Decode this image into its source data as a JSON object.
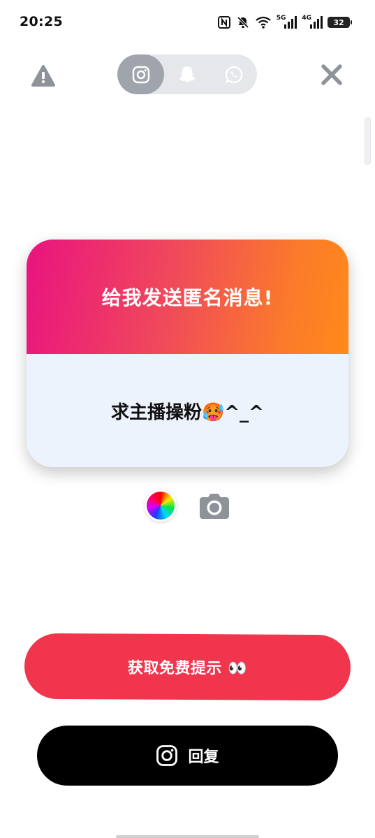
{
  "status_bar": {
    "time": "20:25",
    "network_1": "5G",
    "network_2": "4G",
    "battery": "32",
    "icons": [
      "nfc-icon",
      "bell-muted-icon",
      "wifi-icon",
      "signal-5g-icon",
      "signal-4g-icon",
      "battery-icon"
    ]
  },
  "top_bar": {
    "left_icon": "warning-icon",
    "right_icon": "close-icon",
    "platforms": [
      {
        "name": "instagram",
        "icon": "instagram-icon",
        "active": true
      },
      {
        "name": "snapchat",
        "icon": "snapchat-icon",
        "active": false
      },
      {
        "name": "whatsapp",
        "icon": "whatsapp-icon",
        "active": false
      }
    ]
  },
  "card": {
    "title": "给我发送匿名消息!",
    "message": "求主播操粉🥵^_^",
    "gradient_colors": [
      "#e91380",
      "#f04a5a",
      "#ff8a1a"
    ],
    "body_color": "#edf3fc"
  },
  "tools": {
    "color_picker_icon": "color-wheel-icon",
    "camera_icon": "camera-icon"
  },
  "buttons": {
    "hint_label": "获取免费提示 👀",
    "hint_color": "#f0354d",
    "reply_label": "回复",
    "reply_icon": "instagram-icon",
    "reply_color": "#000000"
  }
}
